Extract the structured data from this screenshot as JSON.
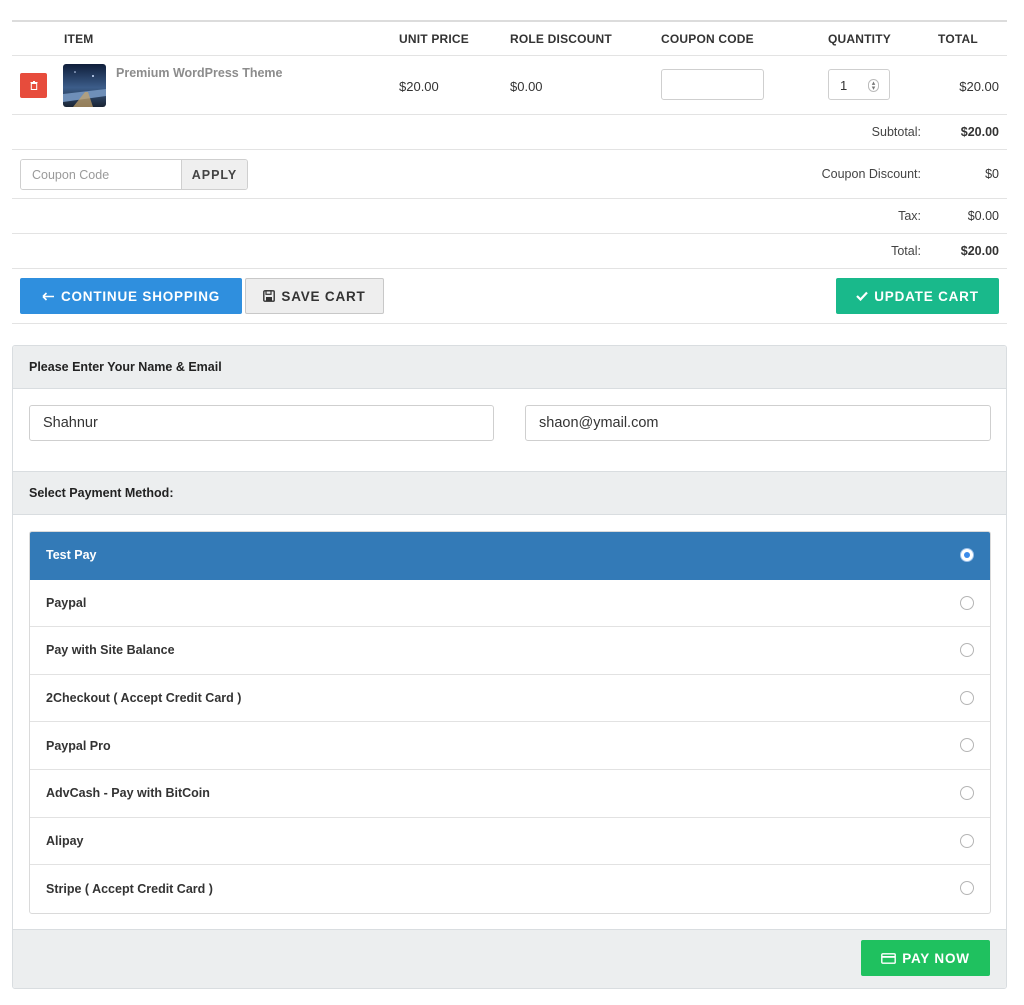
{
  "cart": {
    "headers": {
      "item": "ITEM",
      "unit_price": "UNIT PRICE",
      "role_discount": "ROLE DISCOUNT",
      "coupon_code": "COUPON CODE",
      "quantity": "QUANTITY",
      "total": "TOTAL"
    },
    "items": [
      {
        "name": "Premium WordPress Theme",
        "unit_price": "$20.00",
        "role_discount": "$0.00",
        "coupon_code": "",
        "quantity": "1",
        "total": "$20.00"
      }
    ],
    "subtotal_label": "Subtotal:",
    "subtotal_value": "$20.00",
    "coupon_placeholder": "Coupon Code",
    "apply_label": "APPLY",
    "coupon_discount_label": "Coupon Discount:",
    "coupon_discount_value": "$0",
    "tax_label": "Tax:",
    "tax_value": "$0.00",
    "total_label": "Total:",
    "total_value": "$20.00"
  },
  "actions": {
    "continue_label": "CONTINUE SHOPPING",
    "save_label": "SAVE CART",
    "update_label": "UPDATE CART"
  },
  "checkout": {
    "name_email_heading": "Please Enter Your Name & Email",
    "name_value": "Shahnur",
    "email_value": "shaon@ymail.com",
    "payment_heading": "Select Payment Method:",
    "methods": [
      {
        "label": "Test Pay",
        "selected": true
      },
      {
        "label": "Paypal",
        "selected": false
      },
      {
        "label": "Pay with Site Balance",
        "selected": false
      },
      {
        "label": "2Checkout ( Accept Credit Card )",
        "selected": false
      },
      {
        "label": "Paypal Pro",
        "selected": false
      },
      {
        "label": "AdvCash - Pay with BitCoin",
        "selected": false
      },
      {
        "label": "Alipay",
        "selected": false
      },
      {
        "label": "Stripe ( Accept Credit Card )",
        "selected": false
      }
    ],
    "pay_label": "PAY NOW"
  },
  "colors": {
    "continue": "#2f8fde",
    "update": "#19b98b",
    "pay": "#1fc15f",
    "selected_method": "#337ab7",
    "delete": "#e74c3c"
  },
  "icons": {
    "delete": "trash-icon",
    "continue": "arrow-left-icon",
    "save": "floppy-disk-icon",
    "update": "checkmark-icon",
    "pay": "credit-card-icon"
  }
}
